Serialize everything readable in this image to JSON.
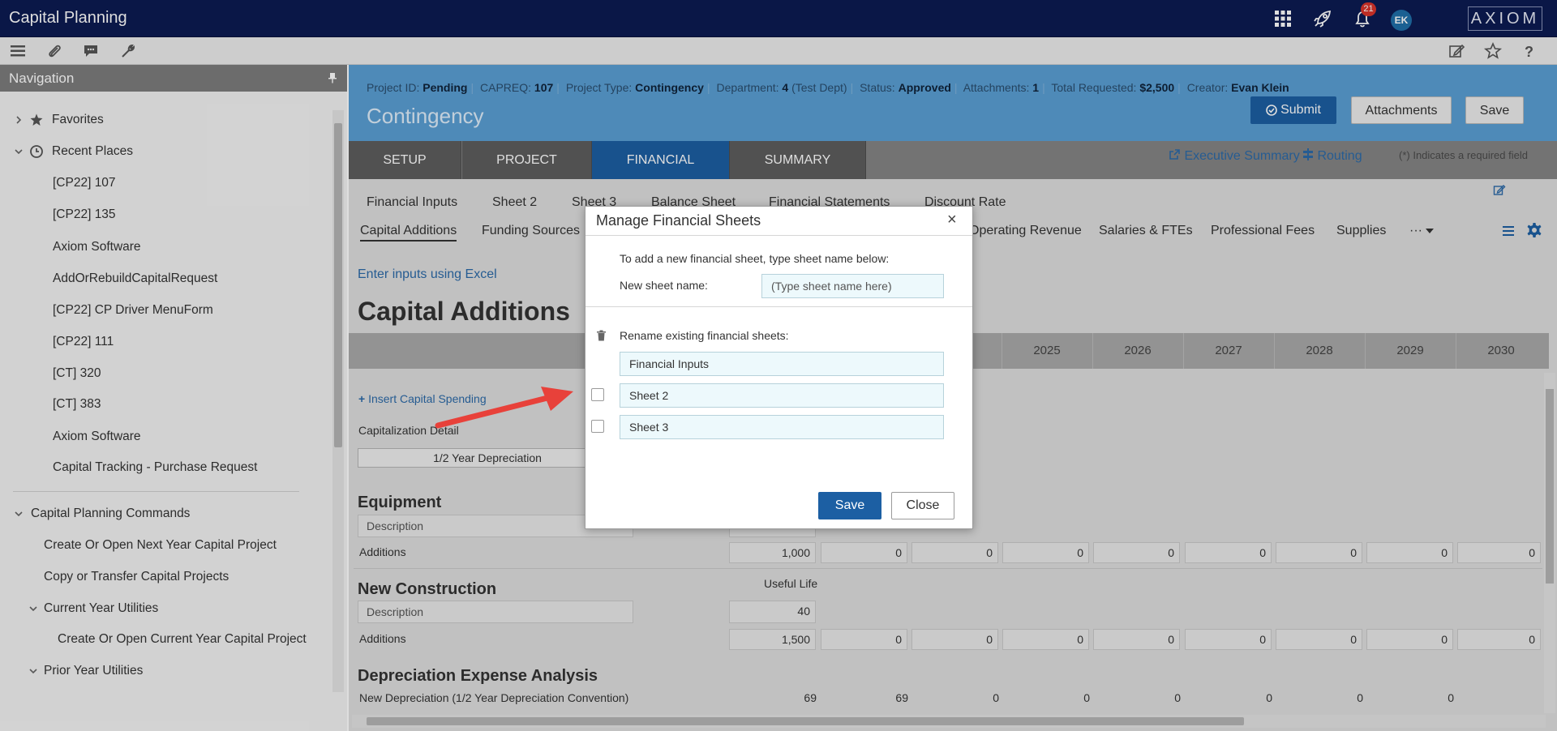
{
  "app": {
    "title": "Capital Planning",
    "notification_count": "21",
    "avatar_initials": "EK",
    "logo": "AXIOM"
  },
  "icons": {
    "top": [
      "apps-grid-icon",
      "rocket-icon",
      "bell-icon"
    ],
    "toolbar_left": [
      "menu-icon",
      "paperclip-icon",
      "chat-icon",
      "wrench-icon"
    ],
    "toolbar_right": [
      "edit-icon",
      "star-icon",
      "help-icon"
    ]
  },
  "navigation": {
    "title": "Navigation",
    "items": [
      {
        "label": "Favorites"
      },
      {
        "label": "Recent Places"
      },
      {
        "label": "[CP22] 107"
      },
      {
        "label": "[CP22] 135"
      },
      {
        "label": "Axiom Software"
      },
      {
        "label": "AddOrRebuildCapitalRequest"
      },
      {
        "label": "[CP22] CP Driver MenuForm"
      },
      {
        "label": "[CP22] 111"
      },
      {
        "label": "[CT] 320"
      },
      {
        "label": "[CT] 383"
      },
      {
        "label": "Axiom Software"
      },
      {
        "label": "Capital Tracking - Purchase Request"
      },
      {
        "label": "Capital Planning Commands"
      },
      {
        "label": "Create Or Open Next Year Capital Project"
      },
      {
        "label": "Copy or Transfer Capital Projects"
      },
      {
        "label": "Current Year Utilities"
      },
      {
        "label": "Create Or Open Current Year Capital Project"
      },
      {
        "label": "Prior Year Utilities"
      }
    ]
  },
  "header": {
    "meta": [
      {
        "label": "Project ID:",
        "value": "Pending"
      },
      {
        "label": "CAPREQ:",
        "value": "107"
      },
      {
        "label": "Project Type:",
        "value": "Contingency"
      },
      {
        "label": "Department:",
        "value": "4",
        "extra": "(Test Dept)"
      },
      {
        "label": "Status:",
        "value": "Approved"
      },
      {
        "label": "Attachments:",
        "value": "1"
      },
      {
        "label": "Total Requested:",
        "value": "$2,500"
      },
      {
        "label": "Creator:",
        "value": "Evan Klein"
      }
    ],
    "title": "Contingency",
    "buttons": {
      "submit": "Submit",
      "attachments": "Attachments",
      "save": "Save"
    }
  },
  "tabs": [
    "SETUP",
    "PROJECT",
    "FINANCIAL",
    "SUMMARY"
  ],
  "header_links": {
    "executive_summary": "Executive Summary",
    "routing": "Routing",
    "required_note": "(*) Indicates a required field"
  },
  "sheet_tabs": [
    "Financial Inputs",
    "Sheet 2",
    "Sheet 3",
    "Balance Sheet",
    "Financial Statements",
    "Discount Rate"
  ],
  "sub_tabs": {
    "left": [
      "Capital Additions",
      "Funding Sources"
    ],
    "right": [
      "Operating Revenue",
      "Salaries & FTEs",
      "Professional Fees",
      "Supplies",
      "···"
    ]
  },
  "content": {
    "excel_link": "Enter inputs using Excel",
    "section_title": "Capital Additions",
    "years": [
      "2025",
      "2026",
      "2027",
      "2028",
      "2029",
      "2030"
    ],
    "insert_link": "Insert Capital Spending",
    "capitalization_label": "Capitalization Detail",
    "depreciation_select": "1/2 Year Depreciation",
    "equipment": {
      "title": "Equipment",
      "description_placeholder": "Description",
      "additions_label": "Additions",
      "values": [
        "1,000",
        "0",
        "0",
        "0",
        "0",
        "0",
        "0",
        "0",
        "0"
      ]
    },
    "new_construction": {
      "title": "New Construction",
      "useful_life_label": "Useful Life",
      "description_placeholder": "Description",
      "useful_life": "40",
      "additions_label": "Additions",
      "values": [
        "1,500",
        "0",
        "0",
        "0",
        "0",
        "0",
        "0",
        "0",
        "0"
      ]
    },
    "depreciation": {
      "title": "Depreciation Expense Analysis",
      "row_label": "New Depreciation (1/2 Year Depreciation Convention)",
      "values": [
        "69",
        "69",
        "0",
        "0",
        "0",
        "0",
        "0",
        "0"
      ]
    }
  },
  "modal": {
    "title": "Manage Financial Sheets",
    "close_symbol": "×",
    "add_instruction": "To add a new financial sheet, type sheet name below:",
    "new_sheet_label": "New sheet name:",
    "new_sheet_placeholder": "(Type sheet name here)",
    "rename_label": "Rename existing financial sheets:",
    "sheets": [
      "Financial Inputs",
      "Sheet 2",
      "Sheet 3"
    ],
    "save": "Save",
    "close": "Close"
  }
}
